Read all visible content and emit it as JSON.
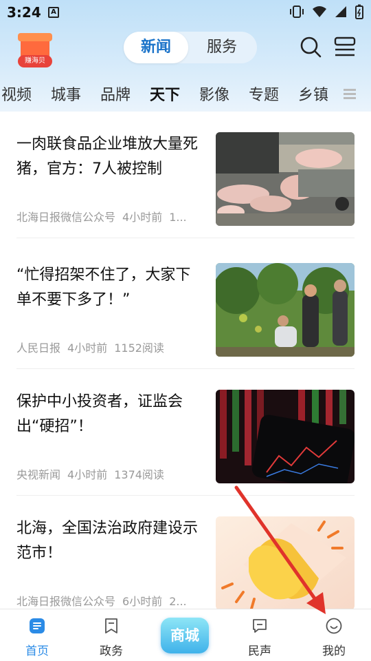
{
  "status_bar": {
    "time": "3:24",
    "notification_badge": "A"
  },
  "header": {
    "logo_label": "赚海贝",
    "segments": [
      {
        "label": "新闻",
        "active": true
      },
      {
        "label": "服务",
        "active": false
      }
    ]
  },
  "channels": [
    {
      "label": "视频",
      "active": false
    },
    {
      "label": "城事",
      "active": false
    },
    {
      "label": "品牌",
      "active": false
    },
    {
      "label": "天下",
      "active": true
    },
    {
      "label": "影像",
      "active": false
    },
    {
      "label": "专题",
      "active": false
    },
    {
      "label": "乡镇",
      "active": false
    }
  ],
  "feed": [
    {
      "title": "一肉联食品企业堆放大量死猪，官方：7人被控制",
      "source": "北海日报微信公众号",
      "time": "4小时前",
      "reads": "1..."
    },
    {
      "title": "“忙得招架不住了，大家下单不要下多了！”",
      "source": "人民日报",
      "time": "4小时前",
      "reads": "1152阅读"
    },
    {
      "title": "保护中小投资者，证监会出“硬招”！",
      "source": "央视新闻",
      "time": "4小时前",
      "reads": "1374阅读"
    },
    {
      "title": "北海，全国法治政府建设示范市！",
      "source": "北海日报微信公众号",
      "time": "6小时前",
      "reads": "2..."
    }
  ],
  "tabbar": {
    "home": "首页",
    "gov": "政务",
    "mall": "商城",
    "voice": "民声",
    "mine": "我的"
  },
  "colors": {
    "accent": "#2b8be6",
    "annotation_arrow": "#e0332b"
  }
}
